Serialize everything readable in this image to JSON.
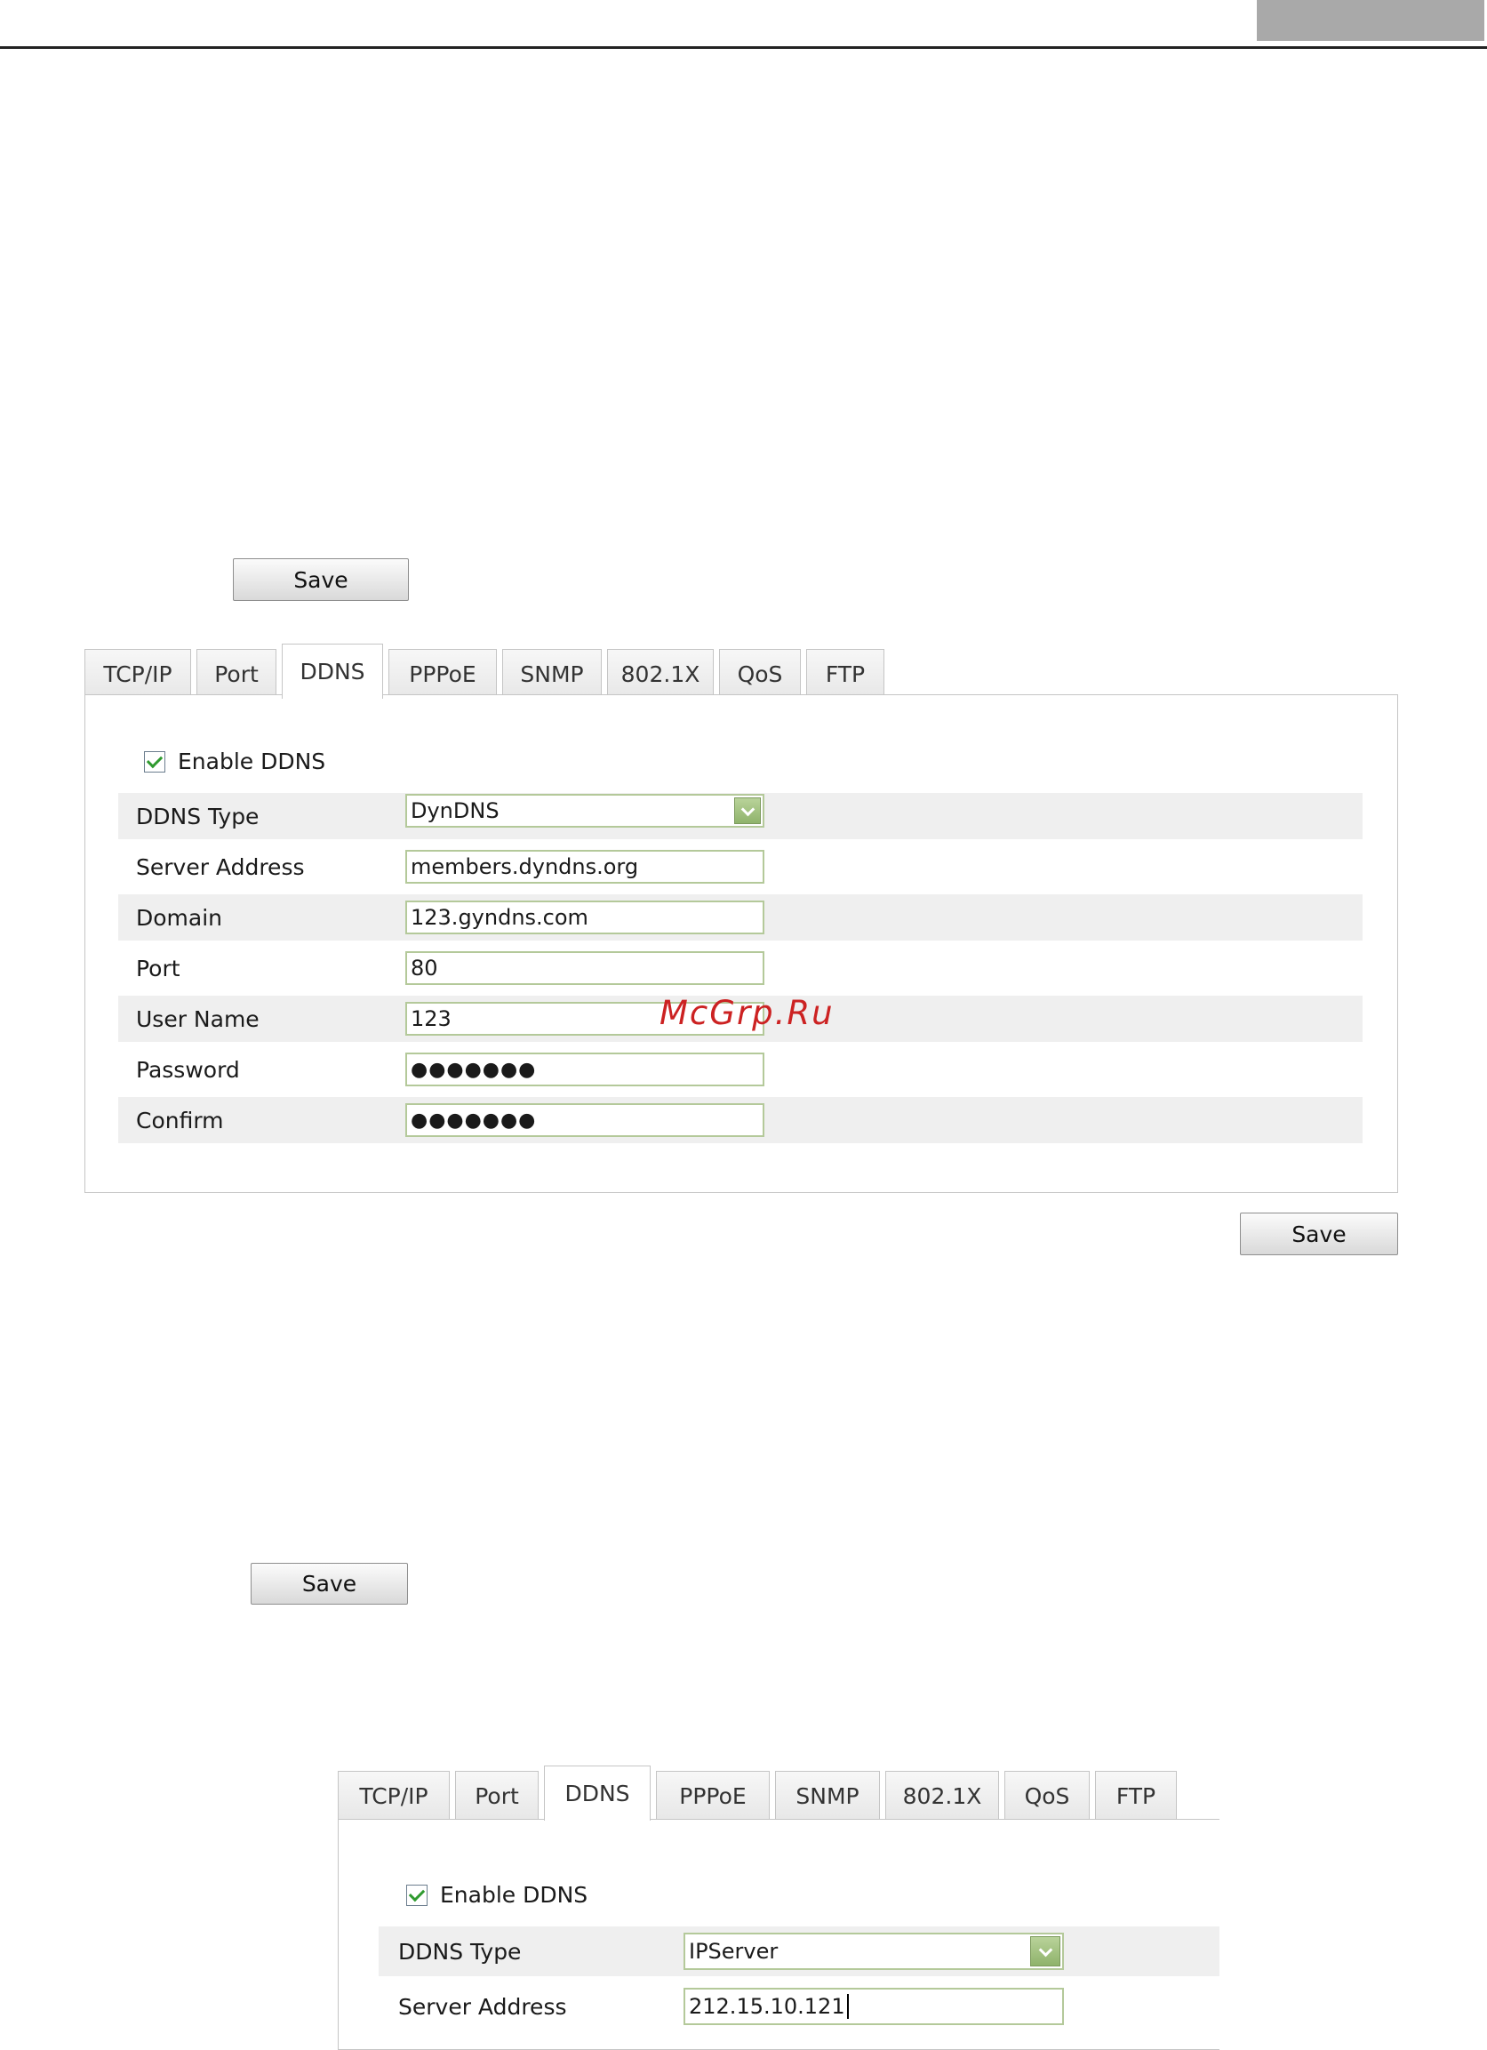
{
  "save_label": "Save",
  "tabs": [
    "TCP/IP",
    "Port",
    "DDNS",
    "PPPoE",
    "SNMP",
    "802.1X",
    "QoS",
    "FTP"
  ],
  "active_tab": "DDNS",
  "enable_label": "Enable DDNS",
  "panel1": {
    "rows": [
      {
        "label": "DDNS Type",
        "value": "DynDNS",
        "kind": "select"
      },
      {
        "label": "Server Address",
        "value": "members.dyndns.org",
        "kind": "text"
      },
      {
        "label": "Domain",
        "value": "123.gyndns.com",
        "kind": "text"
      },
      {
        "label": "Port",
        "value": "80",
        "kind": "text"
      },
      {
        "label": "User Name",
        "value": "123",
        "kind": "text"
      },
      {
        "label": "Password",
        "value": "●●●●●●●",
        "kind": "password"
      },
      {
        "label": "Confirm",
        "value": "●●●●●●●",
        "kind": "password"
      }
    ]
  },
  "panel2": {
    "rows": [
      {
        "label": "DDNS Type",
        "value": "IPServer",
        "kind": "select"
      },
      {
        "label": "Server Address",
        "value": "212.15.10.121",
        "kind": "text"
      }
    ]
  },
  "watermark": "McGrp.Ru",
  "colors": {
    "input_border": "#b4c99a",
    "check": "#2f9a2f",
    "watermark": "#cc2222"
  }
}
